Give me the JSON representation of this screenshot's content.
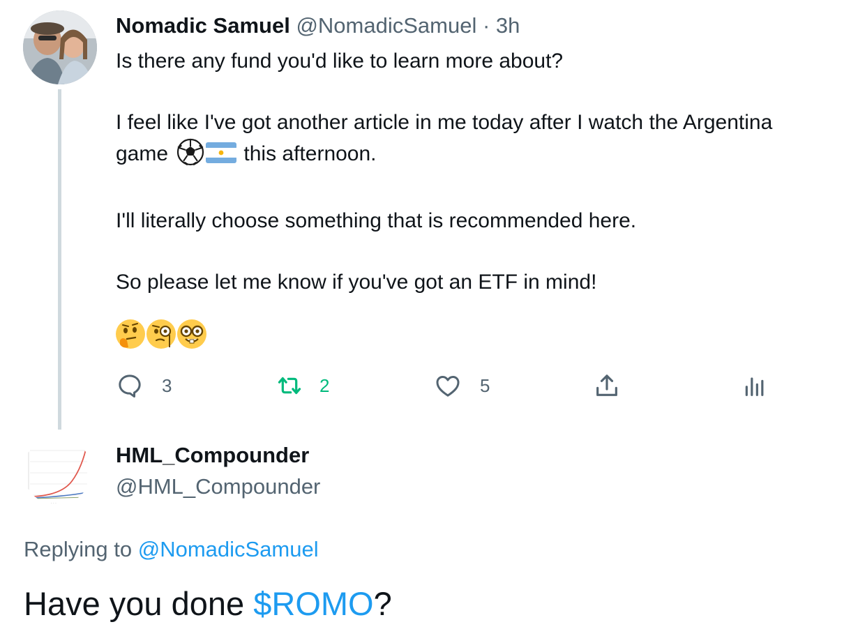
{
  "tweet1": {
    "name": "Nomadic Samuel",
    "handle": "@NomadicSamuel",
    "separator": "·",
    "time": "3h",
    "line1": "Is there any fund you'd like to learn more about?",
    "line2": "I feel like I've got another article in me today after I watch the Argentina",
    "line3_start": "game",
    "line3_end": "this afternoon.",
    "line4": "I'll literally choose something that is recommended here.",
    "line5": "So please let me know if you've got an ETF in mind!",
    "emojis": [
      "thinking-face",
      "face-with-monocle",
      "nerd-face"
    ],
    "actions": {
      "reply_count": "3",
      "retweet_count": "2",
      "like_count": "5"
    }
  },
  "tweet2": {
    "name": "HML_Compounder",
    "handle": "@HML_Compounder",
    "replying_label": "Replying to",
    "replying_handle": "@NomadicSamuel",
    "body_start": "Have you done",
    "cashtag": "$ROMO",
    "body_end": "?"
  },
  "colors": {
    "text": "#0f1419",
    "secondary": "#536471",
    "link": "#1d9bf0",
    "retweet": "#00ba7c",
    "thread_line": "#cfd9de"
  }
}
